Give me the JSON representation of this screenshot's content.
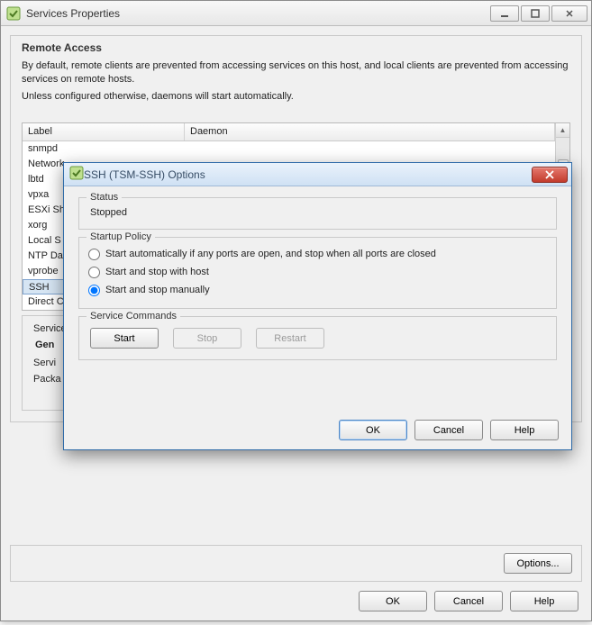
{
  "parent": {
    "title": "Services Properties",
    "remote_access": {
      "heading": "Remote Access",
      "p1": "By default, remote clients are prevented from accessing services on this host, and local clients are prevented from accessing services on remote hosts.",
      "p2": "Unless configured otherwise, daemons will start automatically."
    },
    "columns": {
      "label": "Label",
      "daemon": "Daemon"
    },
    "rows": [
      "snmpd",
      "Network",
      "lbtd",
      "vpxa",
      "ESXi Sh",
      "xorg",
      "Local S",
      "NTP Da",
      "vprobe",
      "SSH",
      "Direct C"
    ],
    "selected_index": 9,
    "options_btn": "Options...",
    "svc_details": {
      "legend": "Service",
      "gen": "Gen",
      "line1": "Servi",
      "line2": "Packa"
    },
    "buttons": {
      "ok": "OK",
      "cancel": "Cancel",
      "help": "Help"
    }
  },
  "dialog": {
    "title": "SSH (TSM-SSH) Options",
    "status": {
      "legend": "Status",
      "value": "Stopped"
    },
    "startup": {
      "legend": "Startup Policy",
      "opt1": "Start automatically if any ports are open, and stop when all ports are closed",
      "opt2": "Start and stop with host",
      "opt3": "Start and stop manually",
      "selected": 2
    },
    "commands": {
      "legend": "Service Commands",
      "start": "Start",
      "stop": "Stop",
      "restart": "Restart"
    },
    "buttons": {
      "ok": "OK",
      "cancel": "Cancel",
      "help": "Help"
    }
  }
}
